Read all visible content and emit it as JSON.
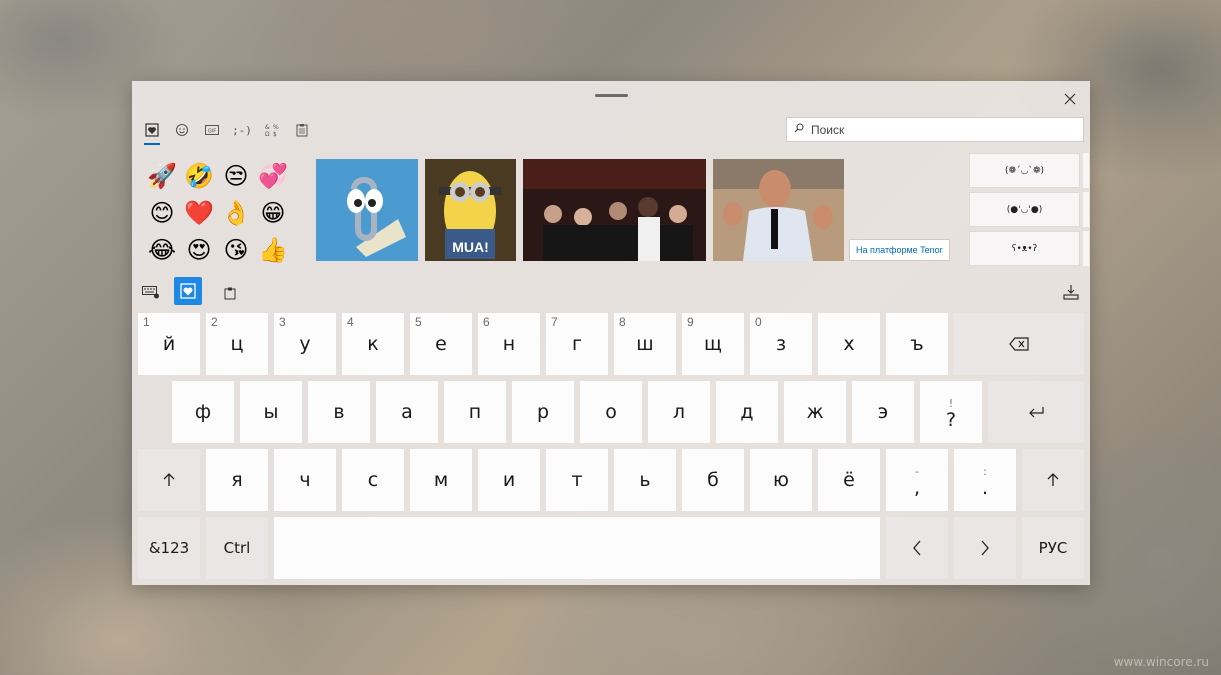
{
  "watermark": "www.wincore.ru",
  "header": {
    "categories": [
      {
        "icon": "heart-frame-icon",
        "glyph": "♥"
      },
      {
        "icon": "smiley-icon",
        "glyph": "☺"
      },
      {
        "icon": "gif-icon",
        "glyph": "GIF"
      },
      {
        "icon": "kaomoji-icon",
        "glyph": ";-)"
      },
      {
        "icon": "symbols-icon",
        "glyph": "Ω"
      },
      {
        "icon": "clipboard-icon",
        "glyph": "▤"
      }
    ],
    "search_placeholder": "Поиск"
  },
  "emojis": [
    "🚀",
    "🤣",
    "😒",
    "💞",
    "😊",
    "❤️",
    "👌",
    "😁",
    "😂",
    "😍",
    "😘",
    "👍"
  ],
  "gifs": [
    {
      "name": "clippy"
    },
    {
      "name": "minion",
      "caption": "MUA!"
    },
    {
      "name": "oscar"
    },
    {
      "name": "man"
    }
  ],
  "tenor_label": "На платформе Tenor",
  "kaomoji": [
    "(❁´◡`❁)",
    "(●'◡'●)",
    "ʕ•ᴥ•ʔ"
  ],
  "keyboard": {
    "row1": [
      {
        "num": "1",
        "ch": "й"
      },
      {
        "num": "2",
        "ch": "ц"
      },
      {
        "num": "3",
        "ch": "у"
      },
      {
        "num": "4",
        "ch": "к"
      },
      {
        "num": "5",
        "ch": "е"
      },
      {
        "num": "6",
        "ch": "н"
      },
      {
        "num": "7",
        "ch": "г"
      },
      {
        "num": "8",
        "ch": "ш"
      },
      {
        "num": "9",
        "ch": "щ"
      },
      {
        "num": "0",
        "ch": "з"
      },
      {
        "num": "",
        "ch": "х"
      },
      {
        "num": "",
        "ch": "ъ"
      }
    ],
    "row2": [
      "ф",
      "ы",
      "в",
      "а",
      "п",
      "р",
      "о",
      "л",
      "д",
      "ж",
      "э"
    ],
    "row2_dual": {
      "top": "!",
      "bot": "?"
    },
    "row3": [
      "я",
      "ч",
      "с",
      "м",
      "и",
      "т",
      "ь",
      "б",
      "ю",
      "ё"
    ],
    "row3_dual": [
      {
        "top": "-",
        "bot": ","
      },
      {
        "top": ":",
        "bot": "."
      }
    ],
    "symbols_label": "&123",
    "ctrl_label": "Ctrl",
    "lang_label": "РУС"
  }
}
